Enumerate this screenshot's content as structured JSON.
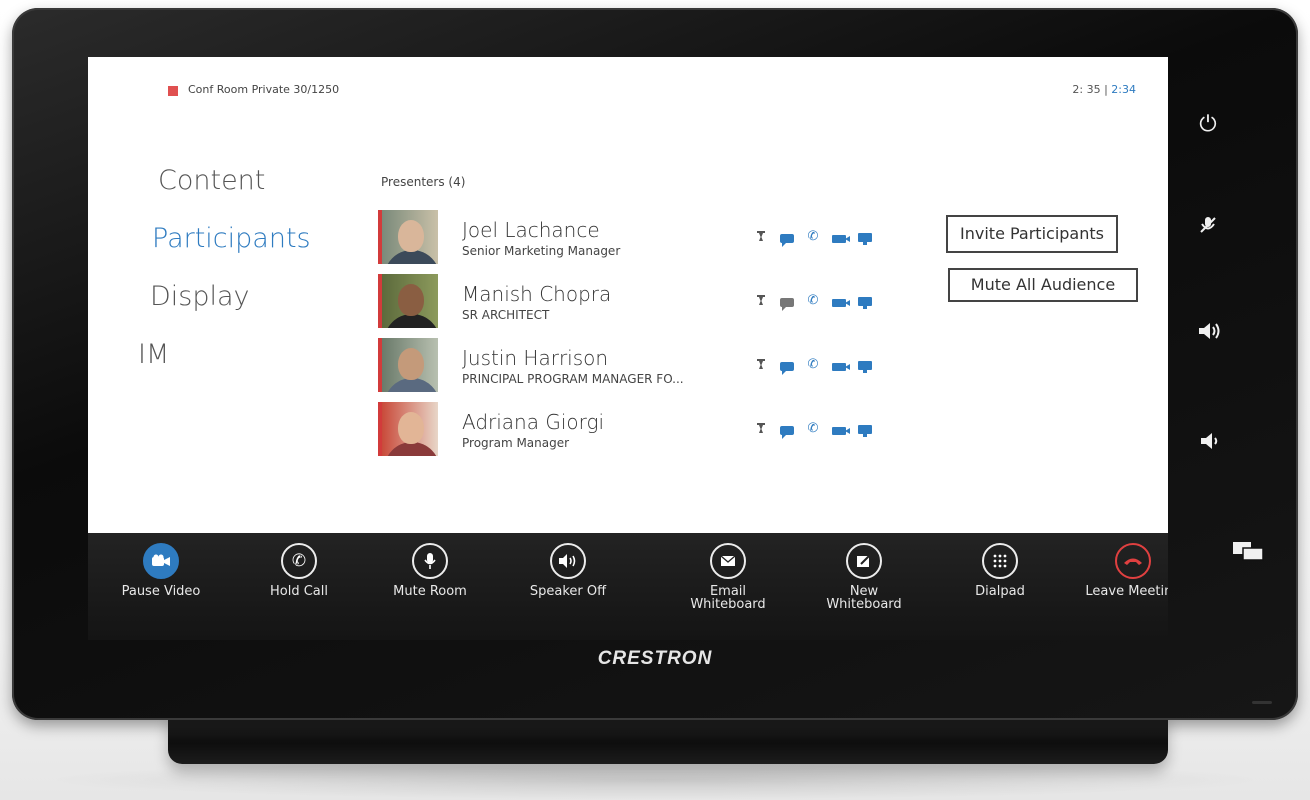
{
  "header": {
    "room_name": "Conf Room Private 30/1250",
    "clock_time": "2: 35 |",
    "clock_time_highlight": " 2:34"
  },
  "nav": {
    "items": [
      {
        "label": "Content",
        "active": false
      },
      {
        "label": "Participants",
        "active": true
      },
      {
        "label": "Display",
        "active": false
      },
      {
        "label": "IM",
        "active": false
      }
    ]
  },
  "presenters": {
    "heading": "Presenters (4)",
    "list": [
      {
        "name": "Joel Lachance",
        "title": "Senior Marketing Manager",
        "chat_active": true
      },
      {
        "name": "Manish Chopra",
        "title": "SR ARCHITECT",
        "chat_active": false
      },
      {
        "name": "Justin Harrison",
        "title": "PRINCIPAL PROGRAM MANAGER FO...",
        "chat_active": true
      },
      {
        "name": "Adriana Giorgi",
        "title": "Program Manager",
        "chat_active": true
      }
    ]
  },
  "actions": {
    "invite_label": "Invite Participants",
    "mute_all_label": "Mute All Audience"
  },
  "toolbar": {
    "pause_video": "Pause Video",
    "hold_call": "Hold Call",
    "mute_room": "Mute Room",
    "speaker_off": "Speaker Off",
    "email_whiteboard": "Email\nWhiteboard",
    "new_whiteboard": "New\nWhiteboard",
    "dialpad": "Dialpad",
    "leave_meeting": "Leave Meeting"
  },
  "device": {
    "brand": "CRESTRON"
  },
  "colors": {
    "accent": "#2e7bc0",
    "status_red": "#e05050",
    "leave_red": "#e04040"
  }
}
